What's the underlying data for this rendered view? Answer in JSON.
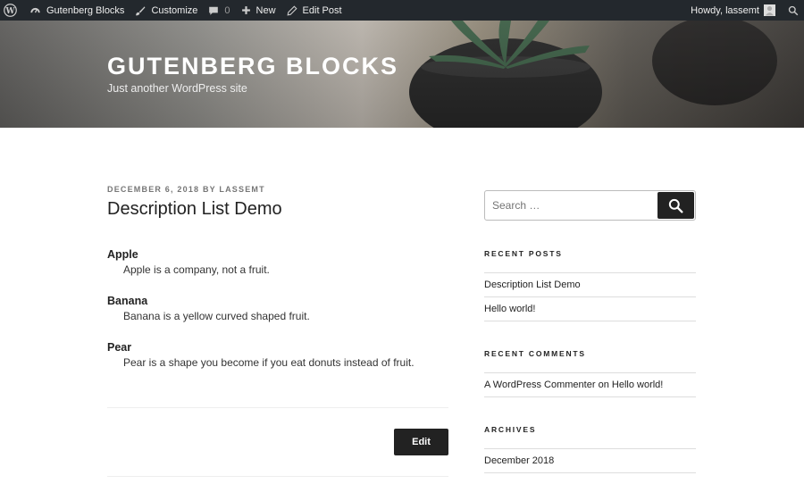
{
  "adminbar": {
    "site_name": "Gutenberg Blocks",
    "customize": "Customize",
    "comments_count": "0",
    "new": "New",
    "edit_post": "Edit Post",
    "howdy": "Howdy, lassemt"
  },
  "header": {
    "title": "GUTENBERG BLOCKS",
    "description": "Just another WordPress site"
  },
  "post": {
    "date": "DECEMBER 6, 2018",
    "by": "BY",
    "author": "LASSEMT",
    "title": "Description List Demo",
    "items": [
      {
        "term": "Apple",
        "desc": "Apple is a company, not a fruit."
      },
      {
        "term": "Banana",
        "desc": "Banana is a yellow curved shaped fruit."
      },
      {
        "term": "Pear",
        "desc": "Pear is a shape you become if you eat donuts instead of fruit."
      }
    ],
    "edit_label": "Edit"
  },
  "sidebar": {
    "search_placeholder": "Search …",
    "recent_posts_title": "RECENT POSTS",
    "recent_posts": [
      "Description List Demo",
      "Hello world!"
    ],
    "recent_comments_title": "RECENT COMMENTS",
    "comment": {
      "author": "A WordPress Commenter",
      "on": "on",
      "post": "Hello world!"
    },
    "archives_title": "ARCHIVES",
    "archives": [
      "December 2018"
    ]
  },
  "colors": {
    "adminbar_bg": "#23282d",
    "button_bg": "#222222",
    "meta_text": "#767676"
  },
  "icons": [
    "wordpress-logo-icon",
    "dashboard-icon",
    "brush-icon",
    "comment-icon",
    "plus-icon",
    "pencil-icon",
    "avatar-icon",
    "search-icon"
  ]
}
